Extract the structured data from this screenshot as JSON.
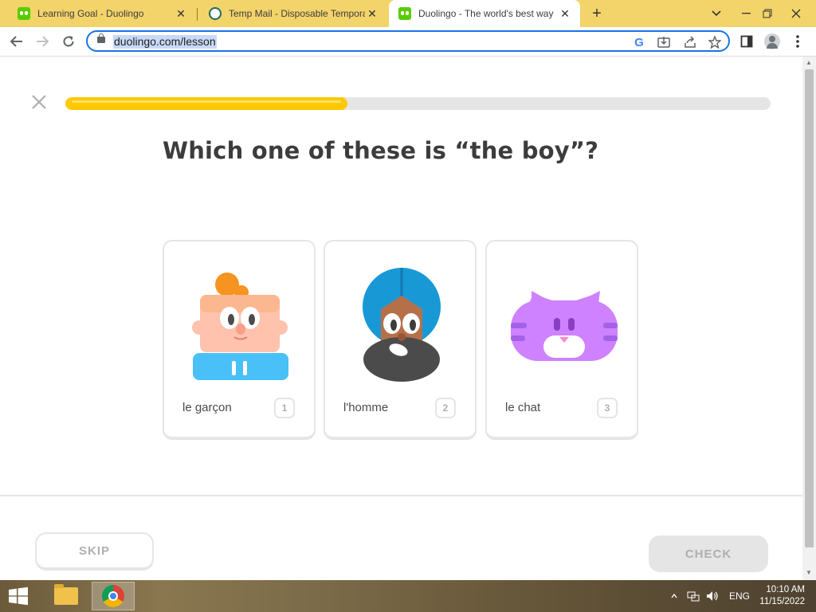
{
  "browser": {
    "tabs": [
      {
        "title": "Learning Goal - Duolingo",
        "icon": "duolingo-owl-icon"
      },
      {
        "title": "Temp Mail - Disposable Tempora",
        "icon": "temp-mail-icon"
      },
      {
        "title": "Duolingo - The world's best way",
        "icon": "duolingo-owl-icon",
        "active": true
      }
    ],
    "url": "duolingo.com/lesson",
    "new_tab_label": "+",
    "close_glyph": "✕"
  },
  "lesson": {
    "progress_percent": 40,
    "question": "Which one of these is “the boy”?",
    "choices": [
      {
        "word": "le garçon",
        "number": "1",
        "image": "boy-character"
      },
      {
        "word": "l'homme",
        "number": "2",
        "image": "man-with-turban-character"
      },
      {
        "word": "le chat",
        "number": "3",
        "image": "purple-cat-character"
      }
    ],
    "skip_label": "SKIP",
    "check_label": "CHECK"
  },
  "colors": {
    "progress_fill": "#ffc800",
    "progress_track": "#e5e5e5",
    "text_dark": "#3c3c3c",
    "button_disabled": "#e5e5e5",
    "focus_blue": "#1a73e8"
  },
  "taskbar": {
    "language": "ENG",
    "time": "10:10 AM",
    "date": "11/15/2022"
  }
}
